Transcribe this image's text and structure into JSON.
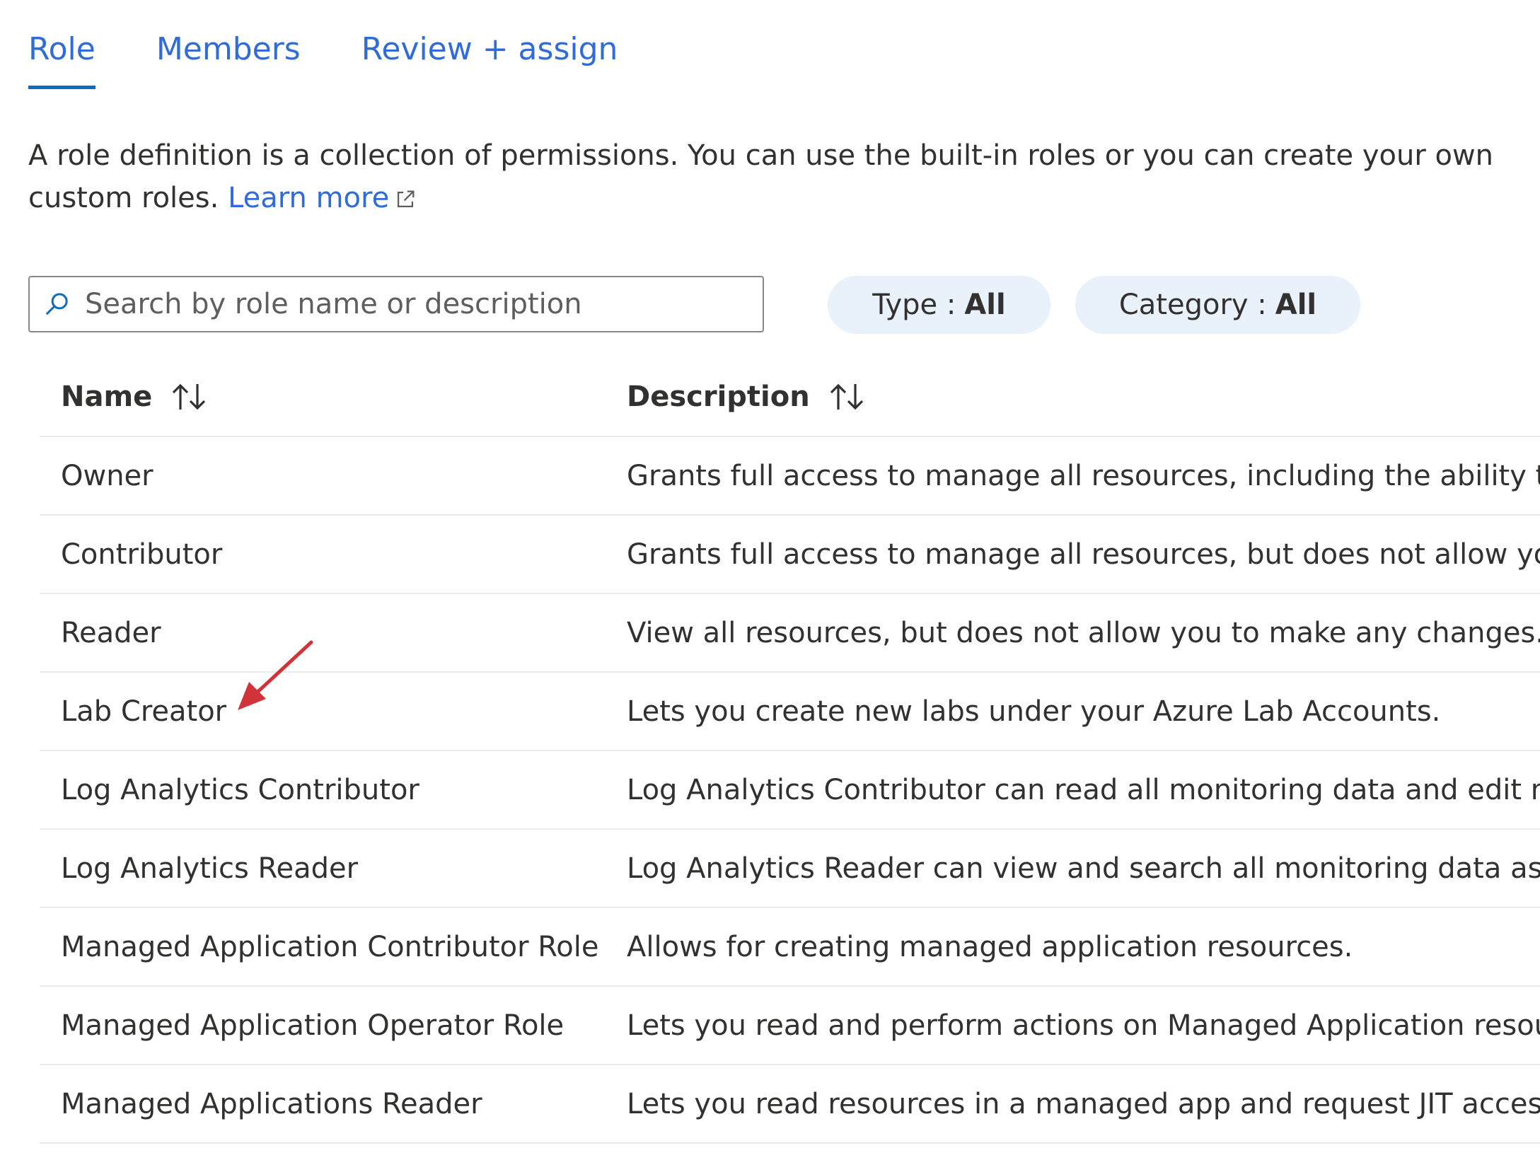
{
  "tabs": [
    {
      "label": "Role",
      "active": true
    },
    {
      "label": "Members",
      "active": false
    },
    {
      "label": "Review + assign",
      "active": false
    }
  ],
  "description": {
    "text": "A role definition is a collection of permissions. You can use the built-in roles or you can create your own custom roles.",
    "link_label": "Learn more"
  },
  "search": {
    "placeholder": "Search by role name or description",
    "value": ""
  },
  "filters": {
    "type_label": "Type :",
    "type_value": "All",
    "category_label": "Category :",
    "category_value": "All"
  },
  "table": {
    "columns": [
      "Name",
      "Description"
    ],
    "rows": [
      {
        "name": "Owner",
        "description": "Grants full access to manage all resources, including the ability to"
      },
      {
        "name": "Contributor",
        "description": "Grants full access to manage all resources, but does not allow you"
      },
      {
        "name": "Reader",
        "description": "View all resources, but does not allow you to make any changes."
      },
      {
        "name": "Lab Creator",
        "description": "Lets you create new labs under your Azure Lab Accounts."
      },
      {
        "name": "Log Analytics Contributor",
        "description": "Log Analytics Contributor can read all monitoring data and edit m"
      },
      {
        "name": "Log Analytics Reader",
        "description": "Log Analytics Reader can view and search all monitoring data as w"
      },
      {
        "name": "Managed Application Contributor Role",
        "description": "Allows for creating managed application resources."
      },
      {
        "name": "Managed Application Operator Role",
        "description": "Lets you read and perform actions on Managed Application resou"
      },
      {
        "name": "Managed Applications Reader",
        "description": "Lets you read resources in a managed app and request JIT access"
      }
    ]
  },
  "colors": {
    "link": "#2f6bd9",
    "tab_underline": "#0f6cbd",
    "pill_bg": "#e9f1fb",
    "annotation_arrow": "#d13438"
  },
  "icons": {
    "search": "search-icon",
    "external": "external-link-icon",
    "sort": "sort-icon",
    "annotation": "annotation-arrow-icon"
  }
}
